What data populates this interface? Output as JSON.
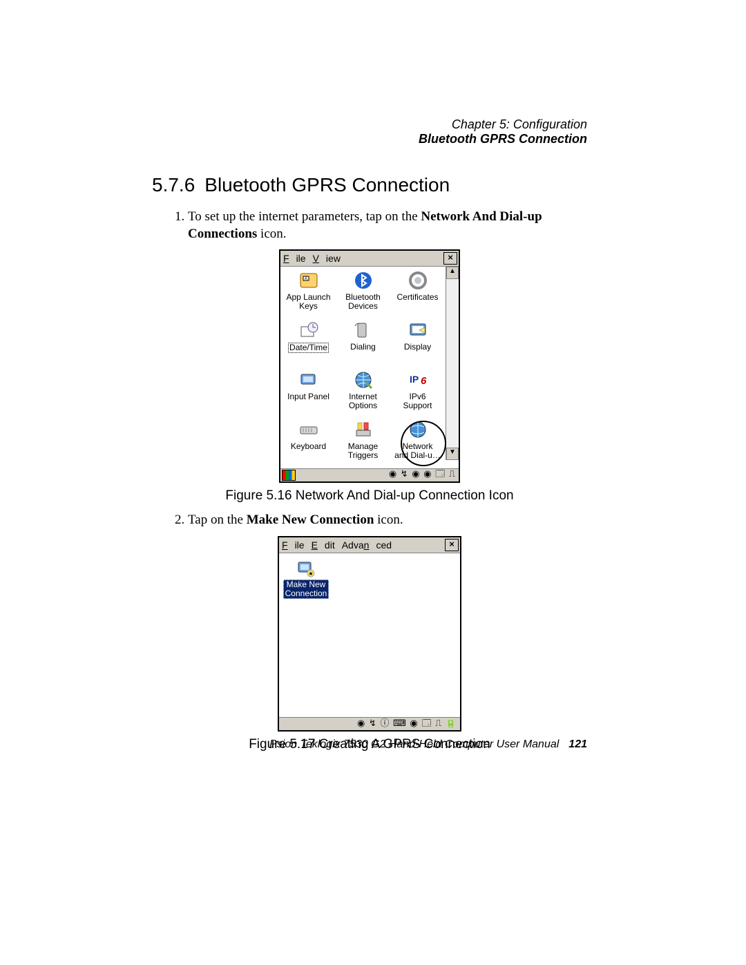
{
  "header": {
    "chapter": "Chapter 5:  Configuration",
    "section": "Bluetooth GPRS Connection"
  },
  "heading": {
    "number": "5.7.6",
    "title": "Bluetooth GPRS Connection"
  },
  "steps": {
    "s1_pre": "To set up the internet parameters, tap on the ",
    "s1_bold": "Network And Dial-up Connections",
    "s1_post": " icon.",
    "s2_pre": "Tap on the ",
    "s2_bold": "Make New Connection",
    "s2_post": " icon."
  },
  "captions": {
    "fig1": "Figure 5.16 Network And Dial-up Connection Icon",
    "fig2": "Figure 5.17 Creating A GPRS Connection"
  },
  "win1": {
    "menu_file": "File",
    "menu_view": "View",
    "close": "×",
    "icons": [
      {
        "label": "App Launch\nKeys",
        "name": "app-launch-keys-icon"
      },
      {
        "label": "Bluetooth\nDevices",
        "name": "bluetooth-devices-icon"
      },
      {
        "label": "Certificates",
        "name": "certificates-icon"
      },
      {
        "label": "Date/Time",
        "name": "date-time-icon",
        "boxed": true
      },
      {
        "label": "Dialing",
        "name": "dialing-icon"
      },
      {
        "label": "Display",
        "name": "display-icon"
      },
      {
        "label": "Input Panel",
        "name": "input-panel-icon"
      },
      {
        "label": "Internet\nOptions",
        "name": "internet-options-icon"
      },
      {
        "label": "IPv6\nSupport",
        "name": "ipv6-support-icon"
      },
      {
        "label": "Keyboard",
        "name": "keyboard-icon"
      },
      {
        "label": "Manage\nTriggers",
        "name": "manage-triggers-icon"
      },
      {
        "label": "Network\nand Dial-u…",
        "name": "network-dialup-icon"
      }
    ],
    "scroll_up": "▲",
    "scroll_down": "▼"
  },
  "win2": {
    "menu_file": "File",
    "menu_edit": "Edit",
    "menu_advanced": "Advanced",
    "close": "×",
    "make_new_label": "Make New\nConnection"
  },
  "footer": {
    "manual": "Psion Teklogix 7530 G2 Hand-Held Computer User Manual",
    "page": "121"
  }
}
